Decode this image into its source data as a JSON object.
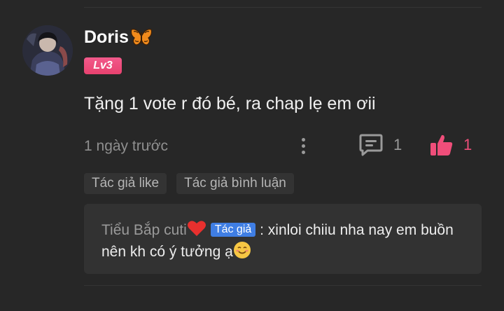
{
  "comment": {
    "username": "Doris",
    "level": "Lv3",
    "text": "Tặng 1 vote r đó bé, ra chap lẹ em ơii",
    "timestamp": "1 ngày trước",
    "reply_count": "1",
    "like_count": "1",
    "tags": [
      "Tác giả like",
      "Tác giả bình luận"
    ]
  },
  "reply": {
    "author": "Tiểu Bắp cuti",
    "author_badge": "Tác giả",
    "separator": " : ",
    "text": "xinloi chiiu nha nay em buồn nên kh có ý tưởng ạ"
  },
  "colors": {
    "background": "#272727",
    "level_badge": "#ea4874",
    "like_accent": "#ef4e7a",
    "author_badge": "#3f7ee4",
    "reply_background": "#323232"
  },
  "icons": {
    "username_decoration": "butterfly-icon",
    "more": "more-vertical-icon",
    "reply": "comment-icon",
    "like": "thumbs-up-icon",
    "reply_author_decoration": "heart-icon",
    "reply_end": "smile-emoji-icon"
  }
}
